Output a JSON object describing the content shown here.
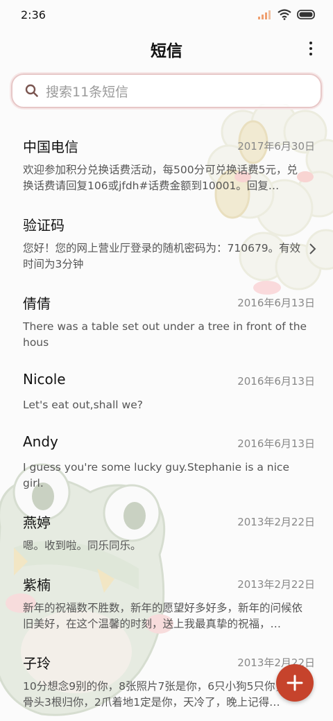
{
  "status_bar": {
    "time": "2:36",
    "battery_icon": "battery-icon",
    "wifi_icon": "wifi-icon",
    "signal_icon": "signal-icon"
  },
  "header": {
    "title": "短信",
    "more_icon": "more-vertical-icon"
  },
  "search": {
    "placeholder": "搜索11条短信",
    "icon": "search-icon"
  },
  "colors": {
    "accent": "#c6432c",
    "search_border": "#e7c7c7",
    "preview_text": "#555555",
    "date_text": "#888888"
  },
  "messages": [
    {
      "name": "中国电信",
      "date": "2017年6月30日",
      "preview": "欢迎参加积分兑换话费活动，每500分可兑换话费5元，兑换话费请回复106或jfdh#话费金额到10001。回复…"
    },
    {
      "name": "验证码",
      "date": "",
      "preview": "您好！您的网上营业厅登录的随机密码为：710679。有效时间为3分钟",
      "has_chevron": true
    },
    {
      "name": "倩倩",
      "date": "2016年6月13日",
      "preview": "There was a table set out under a tree in front of the hous"
    },
    {
      "name": "Nicole",
      "date": "2016年6月13日",
      "preview": "Let's eat out,shall we?"
    },
    {
      "name": "Andy",
      "date": "2016年6月13日",
      "preview": "I guess you're some lucky guy.Stephanie is a nice girl."
    },
    {
      "name": "燕婷",
      "date": "2013年2月22日",
      "preview": "嗯。收到啦。同乐同乐。"
    },
    {
      "name": "紫楠",
      "date": "2013年2月22日",
      "preview": "新年的祝福数不胜数，新年的愿望好多好多，新年的问候依旧美好，在这个温馨的时刻，送上我最真挚的祝福，…"
    },
    {
      "name": "子玲",
      "date": "2013年2月22日",
      "preview": "10分想念9别的你，8张照片7张是你，6只小狗5只你，4根骨头3根归你，2爪着地1定是你，天冷了，晚上记得…"
    }
  ],
  "fab": {
    "icon": "plus-icon"
  }
}
